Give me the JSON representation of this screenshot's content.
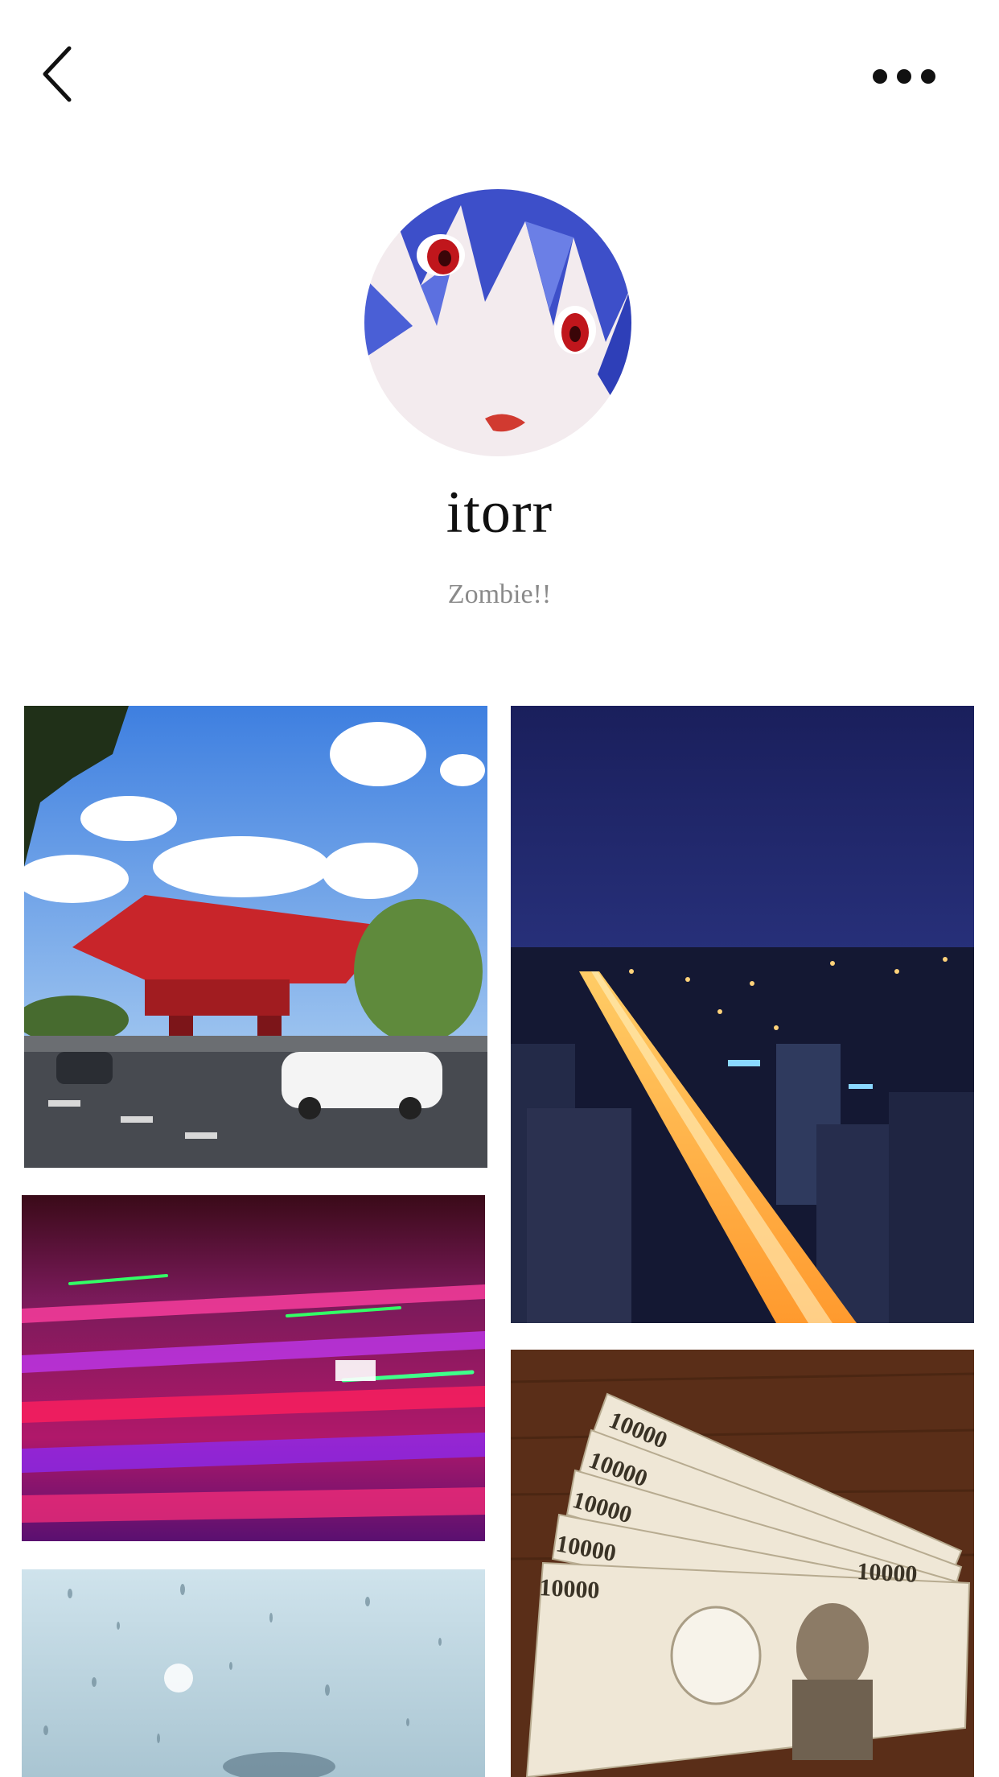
{
  "header": {
    "back_icon": "chevron-left-icon",
    "more_icon": "more-horizontal-icon"
  },
  "profile": {
    "username": "itorr",
    "bio": "Zombie!!"
  },
  "photos": [
    {
      "subject": "red-pavilion-street"
    },
    {
      "subject": "city-night-highway"
    },
    {
      "subject": "concert-lights"
    },
    {
      "subject": "yen-banknotes",
      "banknote_text": "10000"
    },
    {
      "subject": "rainy-window"
    }
  ]
}
